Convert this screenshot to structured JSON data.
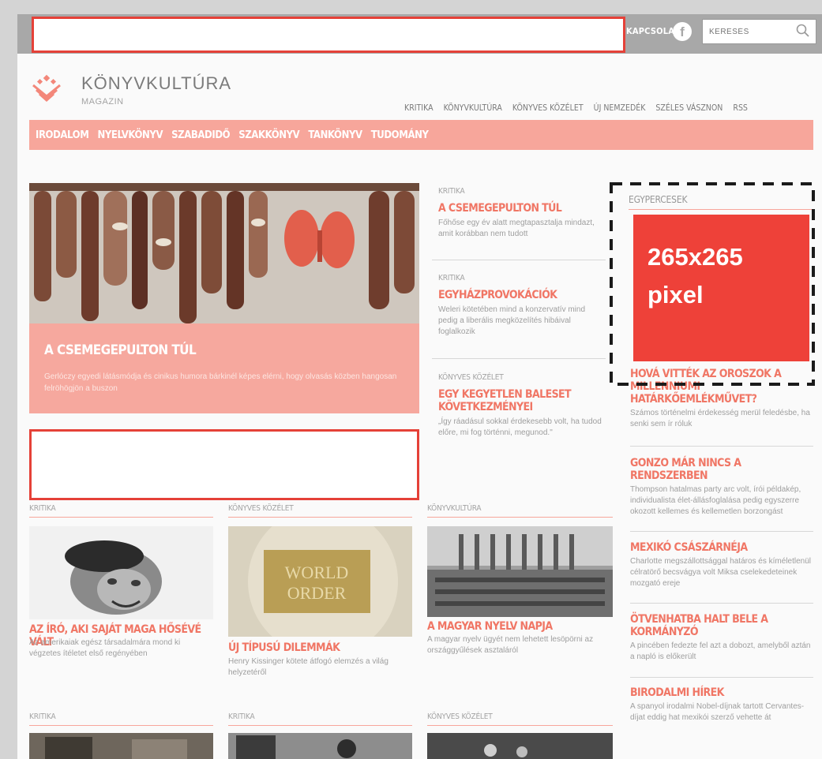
{
  "topbar": {
    "kapcsolat_label": "KAPCSOLAT",
    "facebook_icon": "facebook-icon",
    "search_placeholder": "KERESÉS",
    "search_icon": "search-icon"
  },
  "brand": {
    "name": "KÖNYVKULTÚRA",
    "sub": "MAGAZIN"
  },
  "topnav": [
    "KRITIKA",
    "KÖNYVKULTÚRA",
    "KÖNYVES KÖZÉLET",
    "ÚJ NEMZEDÉK",
    "SZÉLES VÁSZNON",
    "RSS"
  ],
  "catnav": [
    "IRODALOM",
    "NYELVKÖNYV",
    "SZABADIDŐ",
    "SZAKKÖNYV",
    "TANKÖNYV",
    "TUDOMÁNY"
  ],
  "hero": {
    "title": "A CSEMEGEPULTON TÚL",
    "text": "Gerlóczy egyedi látásmódja és cinikus humora bárkinél képes elérni, hogy olvasás közben hangosan felröhögjön a buszon"
  },
  "middle": [
    {
      "category": "KRITIKA",
      "title": "A CSEMEGEPULTON TÚL",
      "excerpt": "Főhőse egy év alatt megtapasztalja mindazt, amit korábban nem tudott"
    },
    {
      "category": "KRITIKA",
      "title": "EGYHÁZPROVOKÁCIÓK",
      "excerpt": "Weleri kötetében mind a konzervatív mind pedig a liberális megközelítés hibáival foglalkozik"
    },
    {
      "category": "KÖNYVES KÖZÉLET",
      "title": "EGY KEGYETLEN BALESET KÖVETKEZMÉNYEI",
      "excerpt": "„Így ráadásul sokkal érdekesebb volt, ha tudod előre, mi fog történni, megunod.\""
    }
  ],
  "egypercesek": {
    "heading": "EGYPERCESEK",
    "ad_line1": "265x265",
    "ad_line2": "pixel",
    "items": [
      {
        "title": "HOVÁ VITTÉK AZ OROSZOK A MILLENNIUMI HATÁRKŐEMLÉKMŰVET?",
        "excerpt": "Számos történelmi érdekesség merül feledésbe, ha senki sem ír róluk"
      },
      {
        "title": "GONZO MÁR NINCS A RENDSZERBEN",
        "excerpt": "Thompson hatalmas party arc volt, írói példakép, individualista élet-állásfoglalása pedig egyszerre okozott kellemes és kellemetlen borzongást"
      },
      {
        "title": "MEXIKÓ CSÁSZÁRNÉJA",
        "excerpt": "Charlotte megszállottsággal határos és kíméletlenül célratörő becsvágya volt Miksa cselekedeteinek mozgató ereje"
      },
      {
        "title": "ÖTVENHATBA HALT BELE A KORMÁNYZÓ",
        "excerpt": "A pincében fedezte fel azt a dobozt, amelyből aztán a napló is előkerült"
      },
      {
        "title": "BIRODALMI HÍREK",
        "excerpt": "A spanyol irodalmi Nobel-díjnak tartott Cervantes-díjat eddig hat mexikói szerző vehette át"
      }
    ]
  },
  "grid": [
    {
      "category": "KRITIKA",
      "title": "AZ ÍRÓ, AKI SAJÁT MAGA HŐSÉVÉ VÁLT",
      "excerpt": "Az amerikaiak egész társadalmára mond ki végzetes ítéletet első regényében"
    },
    {
      "category": "KÖNYVES KÖZÉLET",
      "title": "ÚJ TÍPUSÚ DILEMMÁK",
      "excerpt": "Henry Kissinger kötete átfogó elemzés a világ helyzetéről",
      "image_text_1": "WORLD",
      "image_text_2": "ORDER"
    },
    {
      "category": "KÖNYVKULTÚRA",
      "title": "A MAGYAR NYELV NAPJA",
      "excerpt": "A magyar nyelv ügyét nem lehetett lesöpörni az országgyűlések asztaláról"
    }
  ],
  "grid2": [
    "KRITIKA",
    "KRITIKA",
    "KÖNYVES KÖZÉLET"
  ],
  "colors": {
    "accent": "#f07665",
    "accent_light": "#f7a69b",
    "ad_red": "#ee4139",
    "ad_border": "#e54138"
  }
}
